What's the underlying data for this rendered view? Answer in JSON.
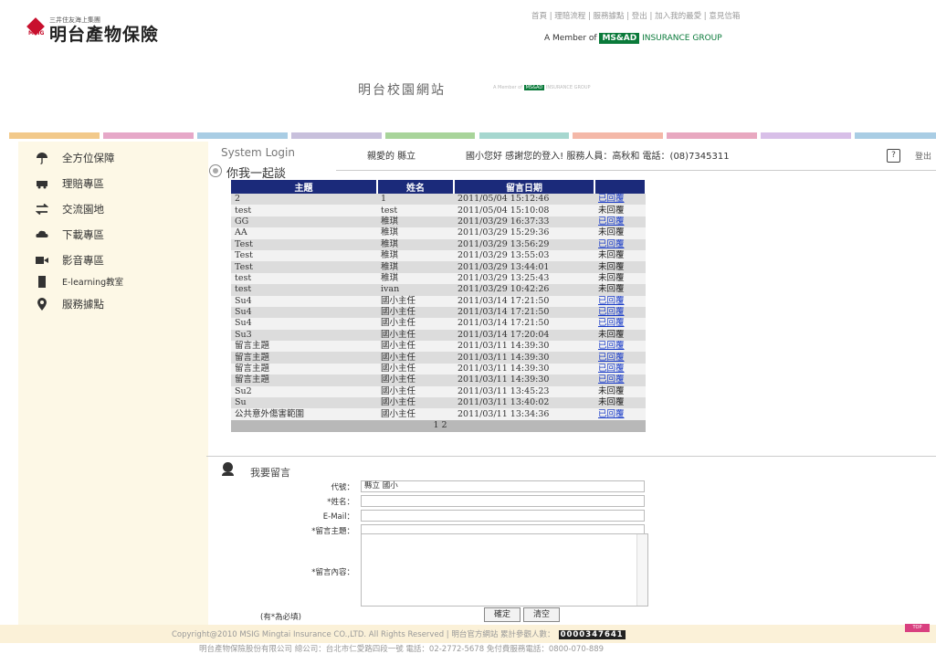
{
  "header": {
    "logo_small": "三井住友海上集團",
    "logo_sub": "MSIG",
    "logo_main": "明台產物保險",
    "top_links": "首頁 | 理賠流程 | 服務據點 | 登出 | 加入我的最愛 | 意見信箱",
    "member_prefix": "A Member of",
    "member_badge": "MS&AD",
    "member_group": "INSURANCE GROUP",
    "site_title": "明台校園網站",
    "tag_prefix": "A Member of",
    "tag_badge": "MS&AD",
    "tag_group": "INSURANCE GROUP"
  },
  "stripe_colors": [
    "#f2c98a",
    "#e6a8c8",
    "#a9cde4",
    "#c8c0dc",
    "#a8d49a",
    "#a6d7cf",
    "#f4b8a8",
    "#e8a8c0",
    "#d8bfe8",
    "#a9cde4"
  ],
  "sidebar": {
    "items": [
      {
        "label": "全方位保障",
        "icon": "umbrella-icon"
      },
      {
        "label": "理賠專區",
        "icon": "car-icon"
      },
      {
        "label": "交流園地",
        "icon": "exchange-icon"
      },
      {
        "label": "下載專區",
        "icon": "cloud-icon"
      },
      {
        "label": "影音專區",
        "icon": "camera-icon"
      },
      {
        "label": "E-learning教室",
        "icon": "book-icon"
      },
      {
        "label": "服務據點",
        "icon": "location-pin-icon"
      }
    ]
  },
  "main": {
    "system_login": "System Login",
    "greeting_user": "親愛的 縣立",
    "greeting_msg": "國小您好 感謝您的登入! 服務人員：高秋和 電話：(08)7345311",
    "logout": "登出",
    "section_title": "你我一起談"
  },
  "board": {
    "headers": [
      "主題",
      "姓名",
      "留言日期",
      ""
    ],
    "rows": [
      {
        "subject": "2",
        "name": "1",
        "date": "2011/05/04 15:12:46",
        "status": "已回覆",
        "replied": true
      },
      {
        "subject": "test",
        "name": "test",
        "date": "2011/05/04 15:10:08",
        "status": "未回覆",
        "replied": false
      },
      {
        "subject": "GG",
        "name": "稚琪",
        "date": "2011/03/29 16:37:33",
        "status": "已回覆",
        "replied": true
      },
      {
        "subject": "AA",
        "name": "稚琪",
        "date": "2011/03/29 15:29:36",
        "status": "未回覆",
        "replied": false
      },
      {
        "subject": "Test",
        "name": "稚琪",
        "date": "2011/03/29 13:56:29",
        "status": "已回覆",
        "replied": true
      },
      {
        "subject": "Test",
        "name": "稚琪",
        "date": "2011/03/29 13:55:03",
        "status": "未回覆",
        "replied": false
      },
      {
        "subject": "Test",
        "name": "稚琪",
        "date": "2011/03/29 13:44:01",
        "status": "未回覆",
        "replied": false
      },
      {
        "subject": "test",
        "name": "稚琪",
        "date": "2011/03/29 13:25:43",
        "status": "未回覆",
        "replied": false
      },
      {
        "subject": "test",
        "name": "ivan",
        "date": "2011/03/29 10:42:26",
        "status": "未回覆",
        "replied": false
      },
      {
        "subject": "Su4",
        "name": "國小主任",
        "date": "2011/03/14 17:21:50",
        "status": "已回覆",
        "replied": true
      },
      {
        "subject": "Su4",
        "name": "國小主任",
        "date": "2011/03/14 17:21:50",
        "status": "已回覆",
        "replied": true
      },
      {
        "subject": "Su4",
        "name": "國小主任",
        "date": "2011/03/14 17:21:50",
        "status": "已回覆",
        "replied": true
      },
      {
        "subject": "Su3",
        "name": "國小主任",
        "date": "2011/03/14 17:20:04",
        "status": "未回覆",
        "replied": false
      },
      {
        "subject": "留言主題",
        "name": "國小主任",
        "date": "2011/03/11 14:39:30",
        "status": "已回覆",
        "replied": true
      },
      {
        "subject": "留言主題",
        "name": "國小主任",
        "date": "2011/03/11 14:39:30",
        "status": "已回覆",
        "replied": true
      },
      {
        "subject": "留言主題",
        "name": "國小主任",
        "date": "2011/03/11 14:39:30",
        "status": "已回覆",
        "replied": true
      },
      {
        "subject": "留言主題",
        "name": "國小主任",
        "date": "2011/03/11 14:39:30",
        "status": "已回覆",
        "replied": true
      },
      {
        "subject": "Su2",
        "name": "國小主任",
        "date": "2011/03/11 13:45:23",
        "status": "未回覆",
        "replied": false
      },
      {
        "subject": "Su",
        "name": "國小主任",
        "date": "2011/03/11 13:40:02",
        "status": "未回覆",
        "replied": false
      },
      {
        "subject": "公共意外傷害範圍",
        "name": "國小主任",
        "date": "2011/03/11 13:34:36",
        "status": "已回覆",
        "replied": true
      }
    ],
    "pages": "1 2"
  },
  "form": {
    "title": "我要留言",
    "code_label": "代號：",
    "code_value": "縣立    國小",
    "name_label": "*姓名：",
    "name_value": "",
    "email_label": "E-Mail：",
    "email_value": "",
    "subject_label": "*留言主題：",
    "subject_value": "",
    "content_label": "*留言內容：",
    "content_value": "",
    "required_note": "(有*為必填)",
    "confirm_button": "確定",
    "clear_button": "清空"
  },
  "footer": {
    "copyright": "Copyright@2010 MSIG Mingtai Insurance CO.,LTD. All Rights Reserved | 明台官方網站 累計參觀人數：",
    "counter": "0000347641",
    "address": "明台產物保險股份有限公司 總公司：台北市仁愛路四段一號 電話：02-2772-5678 免付費服務電話：0800-070-889",
    "top_button": "TOP"
  }
}
